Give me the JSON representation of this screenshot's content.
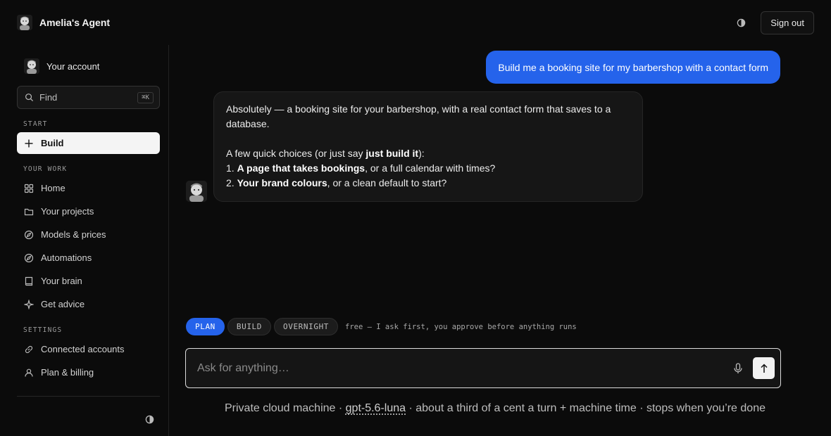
{
  "app": {
    "title": "Amelia's Agent",
    "sign_out_label": "Sign out"
  },
  "sidebar": {
    "account_label": "Your account",
    "find_label": "Find",
    "find_shortcut": "⌘K",
    "sections": {
      "start": "START",
      "your_work": "YOUR WORK",
      "settings": "SETTINGS"
    },
    "start_items": [
      {
        "label": "Build",
        "icon": "plus-icon",
        "active": true
      }
    ],
    "work_items": [
      {
        "label": "Home",
        "icon": "grid-icon"
      },
      {
        "label": "Your projects",
        "icon": "folder-icon"
      },
      {
        "label": "Models & prices",
        "icon": "compass-icon"
      },
      {
        "label": "Automations",
        "icon": "compass-icon"
      },
      {
        "label": "Your brain",
        "icon": "book-icon"
      },
      {
        "label": "Get advice",
        "icon": "sparkle-icon"
      }
    ],
    "settings_items": [
      {
        "label": "Connected accounts",
        "icon": "link-icon"
      },
      {
        "label": "Plan & billing",
        "icon": "user-icon"
      }
    ]
  },
  "chat": {
    "user_message": "Build me a booking site for my barbershop with a contact form",
    "assistant": {
      "line1": "Absolutely — a booking site for your barbershop, with a real contact form that saves to a database.",
      "line2_prefix": "A few quick choices (or just say ",
      "line2_bold": "just build it",
      "line2_suffix": "):",
      "item1_num": "1. ",
      "item1_bold": "A page that takes bookings",
      "item1_rest": ", or a full calendar with times?",
      "item2_num": "2. ",
      "item2_bold": "Your brand colours",
      "item2_rest": ", or a clean default to start?"
    }
  },
  "modes": {
    "items": [
      "PLAN",
      "BUILD",
      "OVERNIGHT"
    ],
    "active": "PLAN",
    "hint": "free — I ask first, you approve before anything runs"
  },
  "composer": {
    "placeholder": "Ask for anything…"
  },
  "footer": {
    "prefix": "Private cloud machine · ",
    "model": "gpt-5.6-luna",
    "suffix": " · about a third of a cent a turn + machine time · stops when you’re done"
  },
  "colors": {
    "accent": "#2563eb",
    "background": "#0b0b0b"
  }
}
